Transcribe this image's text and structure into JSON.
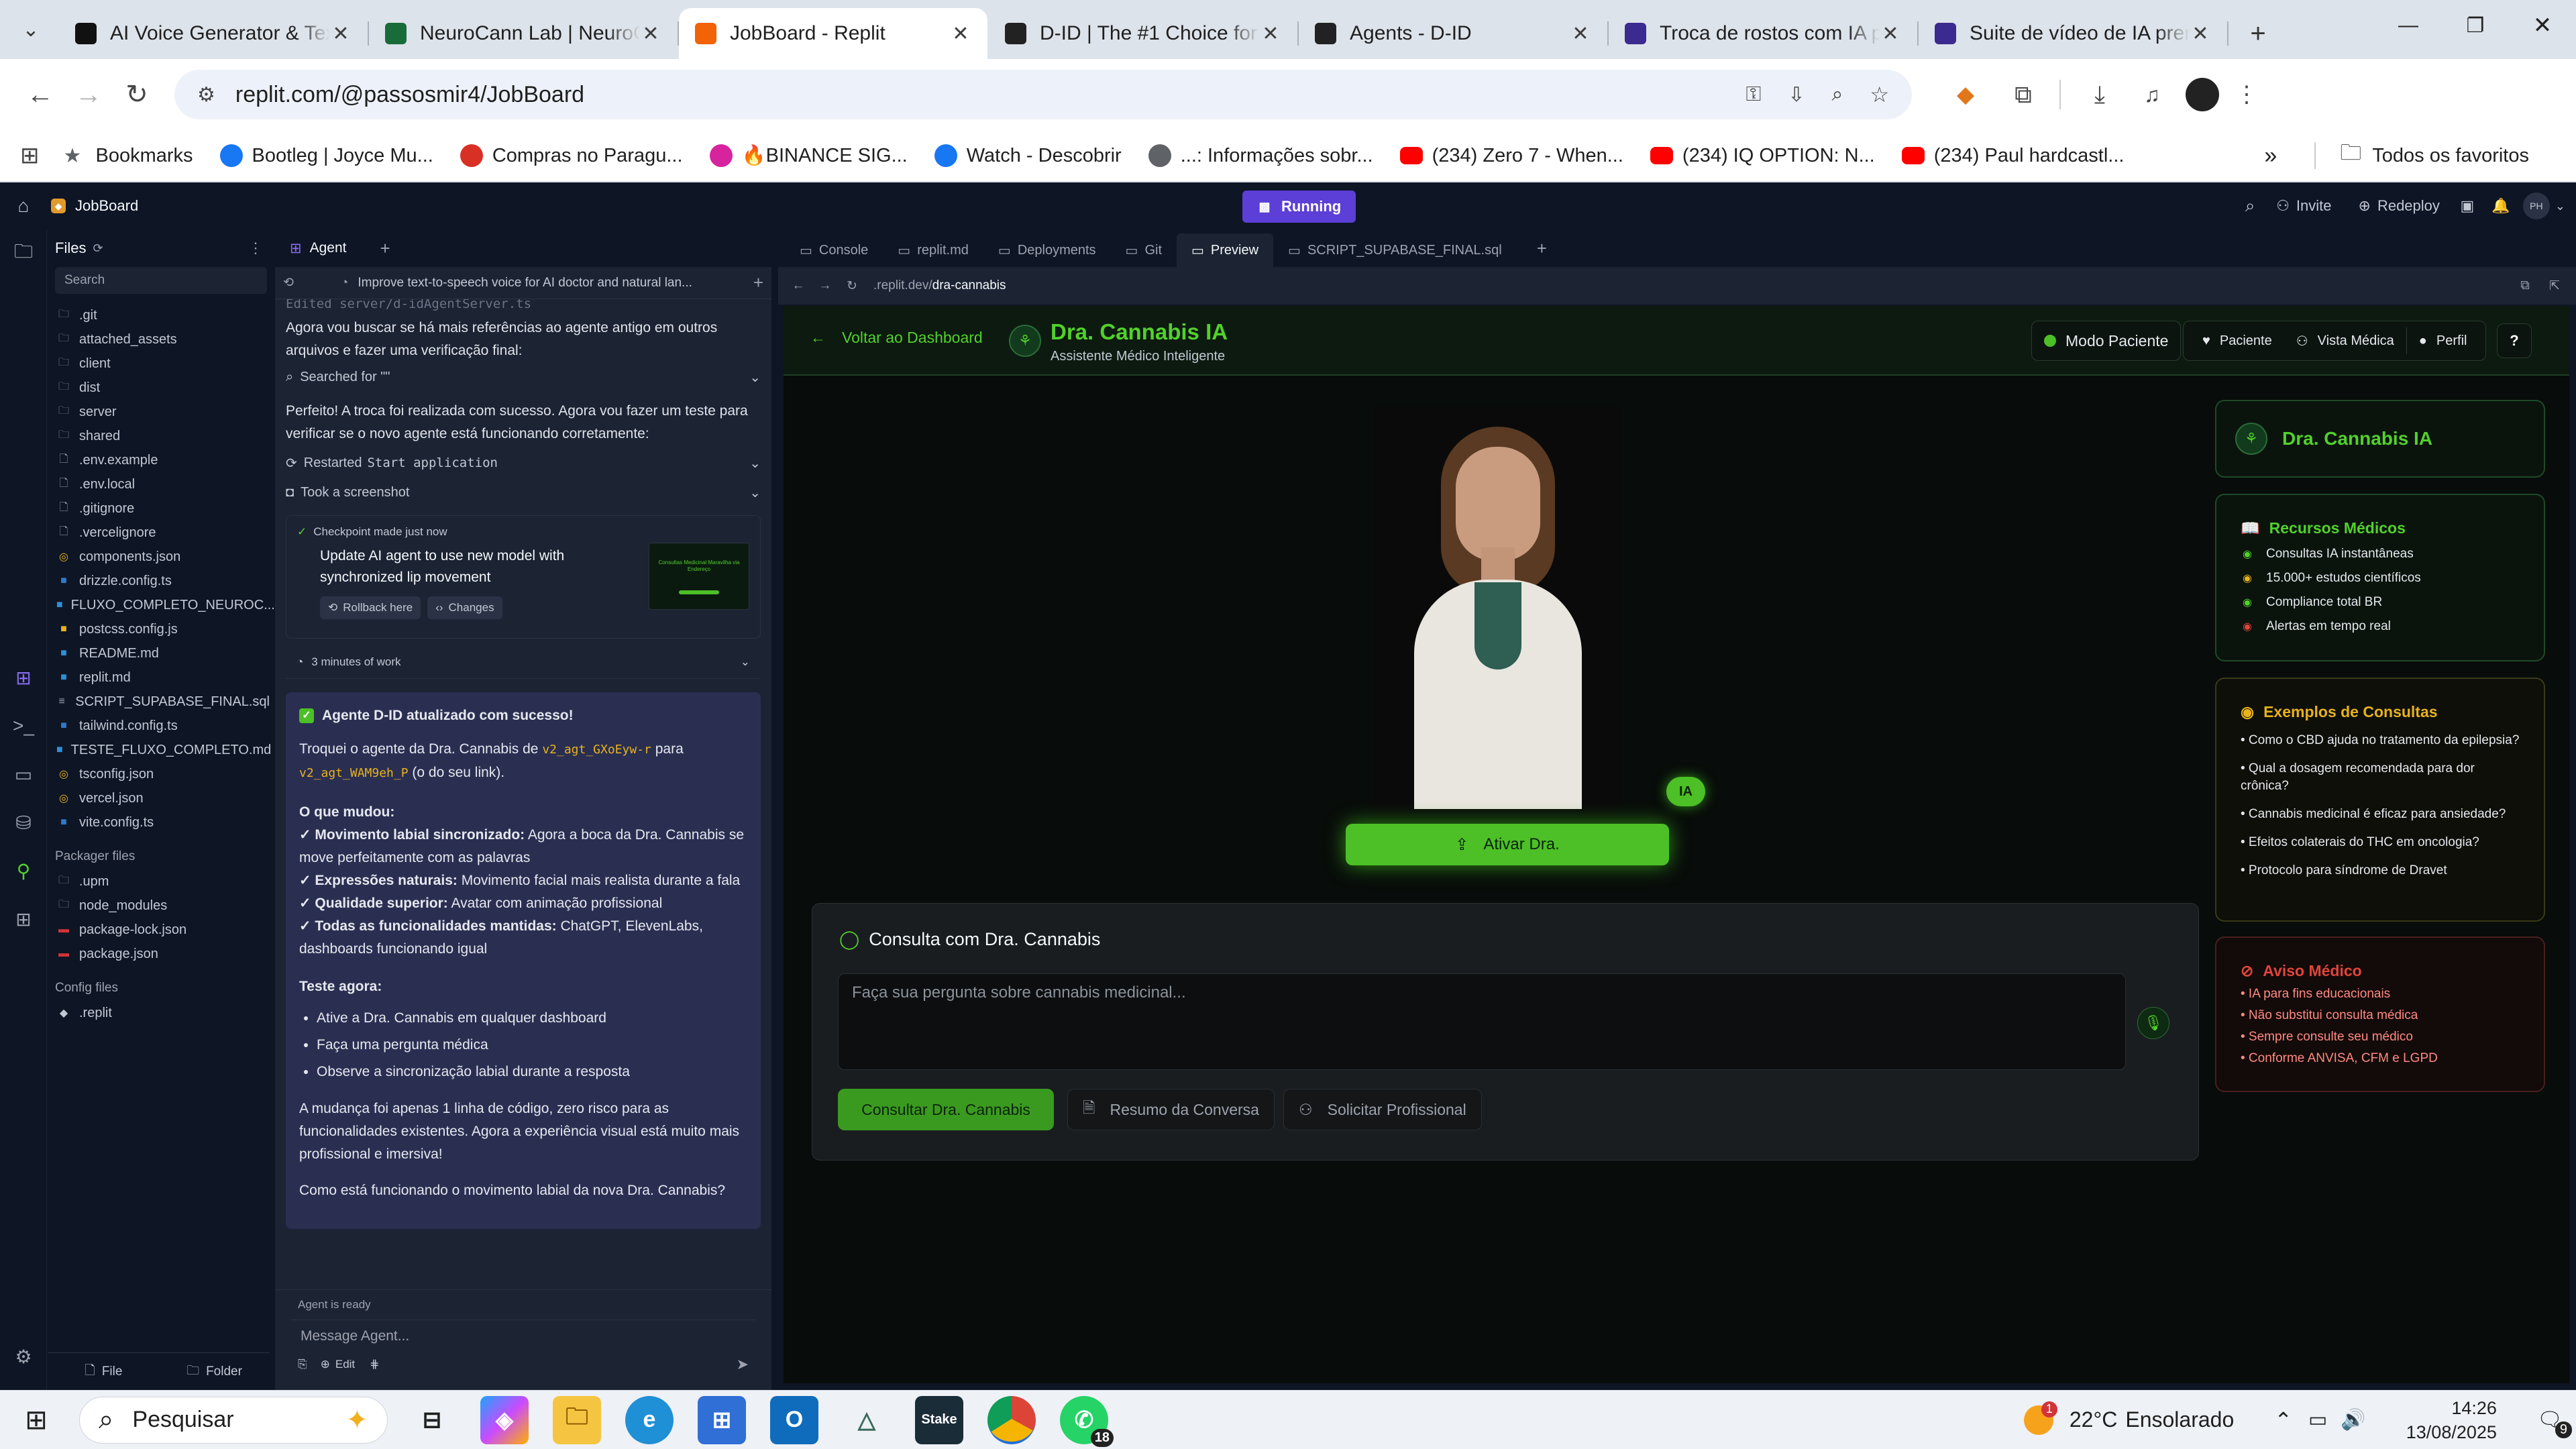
{
  "browser": {
    "tabs": [
      {
        "title": "AI Voice Generator & Text",
        "icon": "elevenlabs-icon",
        "color": "#111111"
      },
      {
        "title": "NeuroCann Lab | NeuroC",
        "icon": "neurocann-icon",
        "color": "#1a6b3a"
      },
      {
        "title": "JobBoard - Replit",
        "icon": "replit-icon",
        "color": "#f26207",
        "active": true
      },
      {
        "title": "D-ID | The #1 Choice for A",
        "icon": "did-icon",
        "color": "#222222"
      },
      {
        "title": "Agents - D-ID",
        "icon": "did-icon",
        "color": "#222222"
      },
      {
        "title": "Troca de rostos com IA pa",
        "icon": "ai-face-icon",
        "color": "#3b2a8f"
      },
      {
        "title": "Suite de vídeo de IA pren",
        "icon": "ai-video-icon",
        "color": "#3b2a8f"
      }
    ],
    "url": "replit.com/@passosmir4/JobBoard",
    "bookmarks": [
      {
        "label": "Bookmarks",
        "icon": "star-icon",
        "color": "#5f6368"
      },
      {
        "label": "Bootleg | Joyce Mu...",
        "icon": "facebook-icon",
        "color": "#1877f2"
      },
      {
        "label": "Compras no Paragu...",
        "icon": "pin-icon",
        "color": "#d93025"
      },
      {
        "label": "🔥BINANCE SIG...",
        "icon": "instagram-icon",
        "color": "#d6249f"
      },
      {
        "label": "Watch - Descobrir",
        "icon": "facebook-icon",
        "color": "#1877f2"
      },
      {
        "label": "...: Informações sobr...",
        "icon": "globe-icon",
        "color": "#5f6368"
      },
      {
        "label": "(234) Zero 7 - When...",
        "icon": "youtube-icon",
        "color": "#ff0000"
      },
      {
        "label": "(234) IQ OPTION: N...",
        "icon": "youtube-icon",
        "color": "#ff0000"
      },
      {
        "label": "(234) Paul hardcastl...",
        "icon": "youtube-icon",
        "color": "#ff0000"
      }
    ],
    "all_bookmarks": "Todos os favoritos",
    "overflow": "»"
  },
  "replit": {
    "project": "JobBoard",
    "status": "Running",
    "invite": "Invite",
    "redeploy": "Redeploy",
    "avatar": "PH",
    "files_title": "Files",
    "search_placeholder": "Search",
    "files": [
      {
        "name": ".git",
        "kind": "folder"
      },
      {
        "name": "attached_assets",
        "kind": "folder"
      },
      {
        "name": "client",
        "kind": "folder"
      },
      {
        "name": "dist",
        "kind": "folder"
      },
      {
        "name": "server",
        "kind": "folder"
      },
      {
        "name": "shared",
        "kind": "folder"
      },
      {
        "name": ".env.example",
        "kind": "file"
      },
      {
        "name": ".env.local",
        "kind": "file"
      },
      {
        "name": ".gitignore",
        "kind": "file"
      },
      {
        "name": ".vercelignore",
        "kind": "file"
      },
      {
        "name": "components.json",
        "kind": "json"
      },
      {
        "name": "drizzle.config.ts",
        "kind": "ts"
      },
      {
        "name": "FLUXO_COMPLETO_NEUROC...",
        "kind": "md"
      },
      {
        "name": "postcss.config.js",
        "kind": "js"
      },
      {
        "name": "README.md",
        "kind": "md"
      },
      {
        "name": "replit.md",
        "kind": "md"
      },
      {
        "name": "SCRIPT_SUPABASE_FINAL.sql",
        "kind": "sql"
      },
      {
        "name": "tailwind.config.ts",
        "kind": "ts"
      },
      {
        "name": "TESTE_FLUXO_COMPLETO.md",
        "kind": "md"
      },
      {
        "name": "tsconfig.json",
        "kind": "json"
      },
      {
        "name": "vercel.json",
        "kind": "json"
      },
      {
        "name": "vite.config.ts",
        "kind": "ts"
      }
    ],
    "packager_title": "Packager files",
    "packager": [
      {
        "name": ".upm",
        "kind": "folder"
      },
      {
        "name": "node_modules",
        "kind": "folder"
      },
      {
        "name": "package-lock.json",
        "kind": "npm"
      },
      {
        "name": "package.json",
        "kind": "npm"
      }
    ],
    "config_title": "Config files",
    "config": [
      {
        "name": ".replit",
        "kind": "replit"
      }
    ],
    "file_btn": "File",
    "folder_btn": "Folder",
    "agent": {
      "tab": "Agent",
      "thread": "Improve text-to-speech voice for AI doctor and natural lan...",
      "faded": "Edited server/d-idAgentServer.ts",
      "msg1": "Agora vou buscar se há mais referências ao agente antigo em outros arquivos e fazer uma verificação final:",
      "searched": "Searched for \"\"",
      "msg2": "Perfeito! A troca foi realizada com sucesso. Agora vou fazer um teste para verificar se o novo agente está funcionando corretamente:",
      "restarted_label": "Restarted",
      "restarted_code": "Start application",
      "screenshot": "Took a screenshot",
      "checkpoint": "Checkpoint made just now",
      "checkpoint_title": "Update AI agent to use new model with synchronized lip movement",
      "rollback": "Rollback here",
      "changes": "Changes",
      "thumb_title": "Consultas Medicinal Maravilha via Endereço",
      "work": "3 minutes of work",
      "success_title": "Agente D-ID atualizado com sucesso!",
      "swap_pre": "Troquei o agente da Dra. Cannabis de",
      "swap_old": "v2_agt_GXoEyw-r",
      "swap_mid": "para",
      "swap_new": "v2_agt_WAM9eh_P",
      "swap_post": "(o do seu link).",
      "changed_title": "O que mudou:",
      "changes_list": [
        {
          "bold": "✓ Movimento labial sincronizado:",
          "text": " Agora a boca da Dra. Cannabis se move perfeitamente com as palavras"
        },
        {
          "bold": "✓ Expressões naturais:",
          "text": " Movimento facial mais realista durante a fala"
        },
        {
          "bold": "✓ Qualidade superior:",
          "text": " Avatar com animação profissional"
        },
        {
          "bold": "✓ Todas as funcionalidades mantidas:",
          "text": " ChatGPT, ElevenLabs, dashboards funcionando igual"
        }
      ],
      "test_title": "Teste agora:",
      "test_list": [
        "Ative a Dra. Cannabis em qualquer dashboard",
        "Faça uma pergunta médica",
        "Observe a sincronização labial durante a resposta"
      ],
      "summary": "A mudança foi apenas 1 linha de código, zero risco para as funcionalidades existentes. Agora a experiência visual está muito mais profissional e imersiva!",
      "question": "Como está funcionando o movimento labial da nova Dra. Cannabis?",
      "ready": "Agent is ready",
      "input_placeholder": "Message Agent...",
      "edit": "Edit"
    },
    "preview_tabs": [
      {
        "label": "Console",
        "icon": "console-icon"
      },
      {
        "label": "replit.md",
        "icon": "file-icon"
      },
      {
        "label": "Deployments",
        "icon": "deploy-icon"
      },
      {
        "label": "Git",
        "icon": "git-icon"
      },
      {
        "label": "Preview",
        "icon": "preview-icon",
        "active": true
      },
      {
        "label": "SCRIPT_SUPABASE_FINAL.sql",
        "icon": "file-icon"
      }
    ],
    "preview_url_prefix": ".replit.dev/",
    "preview_url_path": "dra-cannabis"
  },
  "app": {
    "back": "Voltar ao Dashboard",
    "title": "Dra. Cannabis IA",
    "subtitle": "Assistente Médico Inteligente",
    "mode": "Modo Paciente",
    "nav": [
      "Paciente",
      "Vista Médica",
      "Perfil"
    ],
    "help": "?",
    "ia_badge": "IA",
    "activate": "Ativar Dra.",
    "consult_title": "Consulta com Dra. Cannabis",
    "consult_placeholder": "Faça sua pergunta sobre cannabis medicinal...",
    "consult_btn": "Consultar Dra. Cannabis",
    "summary_btn": "Resumo da Conversa",
    "pro_btn": "Solicitar Profissional",
    "side_title": "Dra. Cannabis IA",
    "resources_title": "Recursos Médicos",
    "resources": [
      {
        "label": "Consultas IA instantâneas",
        "color": "#52d12b"
      },
      {
        "label": "15.000+ estudos científicos",
        "color": "#e8b21c"
      },
      {
        "label": "Compliance total BR",
        "color": "#52d12b"
      },
      {
        "label": "Alertas em tempo real",
        "color": "#e0453a"
      }
    ],
    "examples_title": "Exemplos de Consultas",
    "examples": [
      "• Como o CBD ajuda no tratamento da epilepsia?",
      "• Qual a dosagem recomendada para dor crônica?",
      "• Cannabis medicinal é eficaz para ansiedade?",
      "• Efeitos colaterais do THC em oncologia?",
      "• Protocolo para síndrome de Dravet"
    ],
    "warning_title": "Aviso Médico",
    "warnings": [
      "• IA para fins educacionais",
      "• Não substitui consulta médica",
      "• Sempre consulte seu médico",
      "• Conforme ANVISA, CFM e LGPD"
    ]
  },
  "taskbar": {
    "search": "Pesquisar",
    "whatsapp_badge": "18",
    "weather_temp": "22°C",
    "weather_text": "Ensolarado",
    "weather_badge": "1",
    "time": "14:26",
    "date": "13/08/2025",
    "notif_badge": "9"
  },
  "colors": {
    "accent_green": "#4cc026",
    "replit_bg": "#0e1525",
    "running_purple": "#5b3fd6"
  }
}
